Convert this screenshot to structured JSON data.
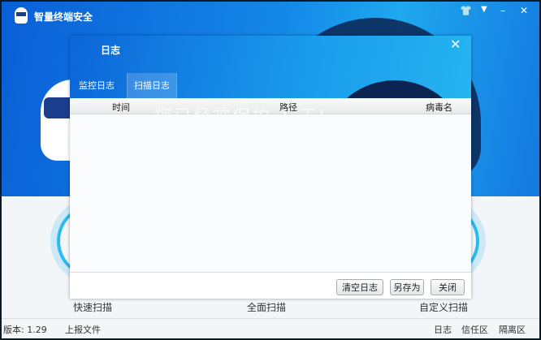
{
  "app": {
    "title": "智量终端安全"
  },
  "window_controls": {
    "skin": "👕",
    "menu": "▼",
    "minimize": "–",
    "close": "✕"
  },
  "background": {
    "protected_text": "您已经被保护 1 天!",
    "scan_labels": [
      "快速扫描",
      "全面扫描",
      "自定义扫描"
    ]
  },
  "status_bar": {
    "version": "版本: 1.29",
    "report": "上报文件",
    "links": [
      "日志",
      "信任区",
      "隔离区"
    ]
  },
  "dialog": {
    "title": "日志",
    "close": "✕",
    "tabs": [
      {
        "label": "监控日志",
        "active": false
      },
      {
        "label": "扫描日志",
        "active": true
      }
    ],
    "columns": [
      "时间",
      "路径",
      "病毒名"
    ],
    "rows": [],
    "buttons": {
      "clear": "清空日志",
      "save_as": "另存为",
      "close": "关闭"
    }
  }
}
